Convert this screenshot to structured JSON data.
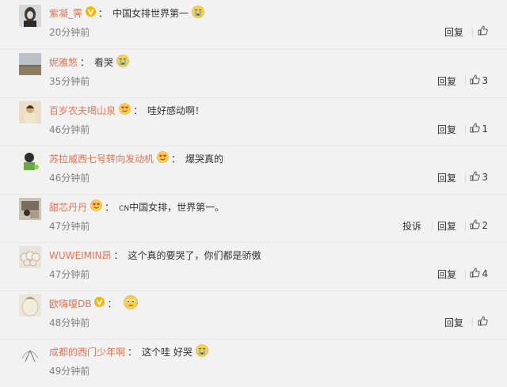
{
  "comments": [
    {
      "user": "紫凝_霁",
      "badge": "gold-v",
      "content": "中国女排世界第一",
      "content_emoji": "crying-emoji",
      "time": "20分钟前",
      "actions": [
        "回复"
      ],
      "likes": ""
    },
    {
      "user": "妮雅悠",
      "badge": null,
      "content": "看哭",
      "content_emoji": "crying-emoji",
      "time": "35分钟前",
      "actions": [
        "回复"
      ],
      "likes": "3"
    },
    {
      "user": "百岁农夫喝山泉",
      "badge": "heart-eyes-emoji",
      "content": "哇好感动啊！",
      "content_emoji": null,
      "time": "46分钟前",
      "actions": [
        "回复"
      ],
      "likes": "1"
    },
    {
      "user": "苏拉威西七号转向发动机",
      "badge": "heart-eyes-emoji",
      "content": "爆哭真的",
      "content_emoji": null,
      "time": "46分钟前",
      "actions": [
        "回复"
      ],
      "likes": "3"
    },
    {
      "user": "甜芯丹丹",
      "badge": "heart-eyes-emoji",
      "content_prefix": "CN",
      "content": "中国女排，世界第一。",
      "content_emoji": null,
      "time": "47分钟前",
      "actions": [
        "投诉",
        "回复"
      ],
      "likes": "2"
    },
    {
      "user": "WUWEIMIN昂",
      "badge": null,
      "content": "这个真的要哭了，你们都是骄傲",
      "content_emoji": null,
      "time": "47分钟前",
      "actions": [
        "回复"
      ],
      "likes": "4"
    },
    {
      "user": "欧嗨嗄DB",
      "badge": "gold-v",
      "content": "",
      "content_emoji": "sad-emoji",
      "time": "48分钟前",
      "actions": [
        "回复"
      ],
      "likes": ""
    },
    {
      "user": "成都的西门少年啊",
      "badge": null,
      "content": "这个哇 好哭",
      "content_emoji": "crying-emoji",
      "time": "49分钟前",
      "actions": [
        "回复"
      ],
      "likes": ""
    }
  ],
  "colors": {
    "username": "#eb7350",
    "time": "#808080",
    "background": "#f2f2f2"
  }
}
